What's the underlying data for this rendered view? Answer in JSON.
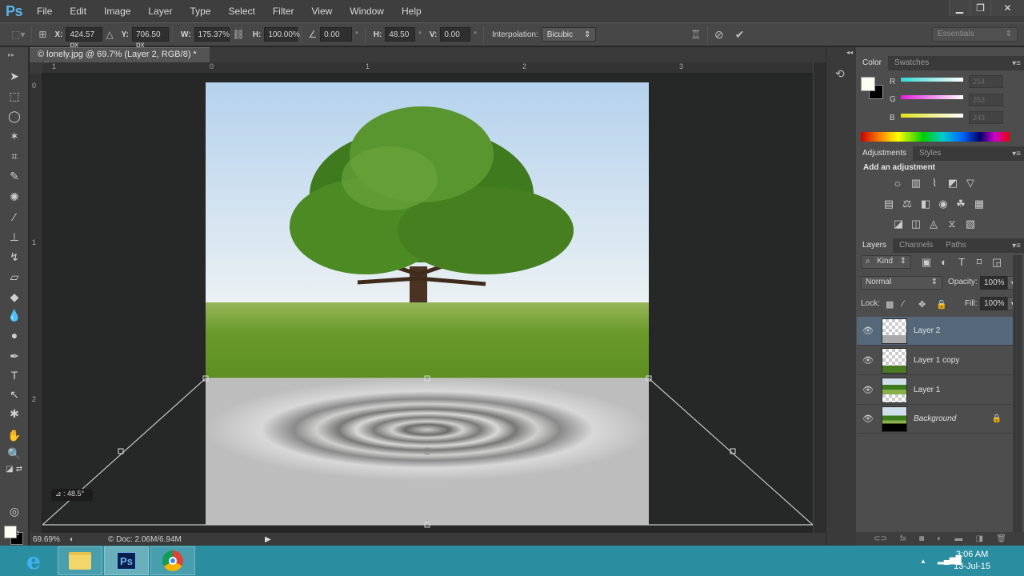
{
  "app": {
    "logo": "Ps"
  },
  "menu": [
    "File",
    "Edit",
    "Image",
    "Layer",
    "Type",
    "Select",
    "Filter",
    "View",
    "Window",
    "Help"
  ],
  "window_controls": {
    "minimize": "▁",
    "restore": "❐",
    "close": "✕"
  },
  "options_bar": {
    "x_label": "X:",
    "x_value": "424.57 px",
    "y_label": "Y:",
    "y_value": "706.50 px",
    "w_label": "W:",
    "w_value": "175.37%",
    "h_label": "H:",
    "h_value": "100.00%",
    "angle_value": "0.00",
    "hskew_label": "H:",
    "hskew_value": "48.50",
    "vskew_label": "V:",
    "vskew_value": "0.00",
    "degree": "°",
    "interpolation_label": "Interpolation:",
    "interpolation_value": "Bicubic",
    "workspace": "Essentials"
  },
  "document": {
    "tab_title": "© lonely.jpg @ 69.7% (Layer 2, RGB/8) *",
    "close": "×",
    "h_ruler": [
      "1",
      "0",
      "1",
      "2",
      "3"
    ],
    "v_ruler": [
      "0",
      "1",
      "2"
    ],
    "angle_tooltip": "⊿ :  48.5°"
  },
  "status": {
    "zoom": "69.69%",
    "doc_size": "© Doc: 2.06M/6.94M",
    "arrow": "▶"
  },
  "color_panel": {
    "tabs": [
      "Color",
      "Swatches"
    ],
    "channels": [
      {
        "label": "R",
        "value": "254",
        "color": "#34d6d6"
      },
      {
        "label": "G",
        "value": "253",
        "color": "#e020d8"
      },
      {
        "label": "B",
        "value": "243",
        "color": "#e2e21c"
      }
    ],
    "foreground": "#fefdf3",
    "background": "#000000"
  },
  "adjustments_panel": {
    "tabs": [
      "Adjustments",
      "Styles"
    ],
    "title": "Add an adjustment",
    "rows": [
      [
        "☼",
        "▥",
        "⌇",
        "◩",
        "▽"
      ],
      [
        "▤",
        "⚖",
        "◧",
        "◉",
        "☘",
        "▦"
      ],
      [
        "◪",
        "◫",
        "◬",
        "⧖",
        "▧"
      ]
    ]
  },
  "layers_panel": {
    "tabs": [
      "Layers",
      "Channels",
      "Paths"
    ],
    "filter": "Kind",
    "blend_mode": "Normal",
    "opacity_label": "Opacity:",
    "opacity": "100%",
    "lock_label": "Lock:",
    "fill_label": "Fill:",
    "fill": "100%",
    "layers": [
      {
        "name": "Layer 2",
        "selected": true,
        "locked": false
      },
      {
        "name": "Layer 1 copy",
        "selected": false,
        "locked": false
      },
      {
        "name": "Layer 1",
        "selected": false,
        "locked": false
      },
      {
        "name": "Background",
        "selected": false,
        "locked": true
      }
    ]
  },
  "taskbar": {
    "apps": [
      "Internet Explorer",
      "File Explorer",
      "Photoshop",
      "Chrome"
    ],
    "ps_label": "Ps",
    "time": "3:06 AM",
    "date": "13-Jul-15"
  }
}
